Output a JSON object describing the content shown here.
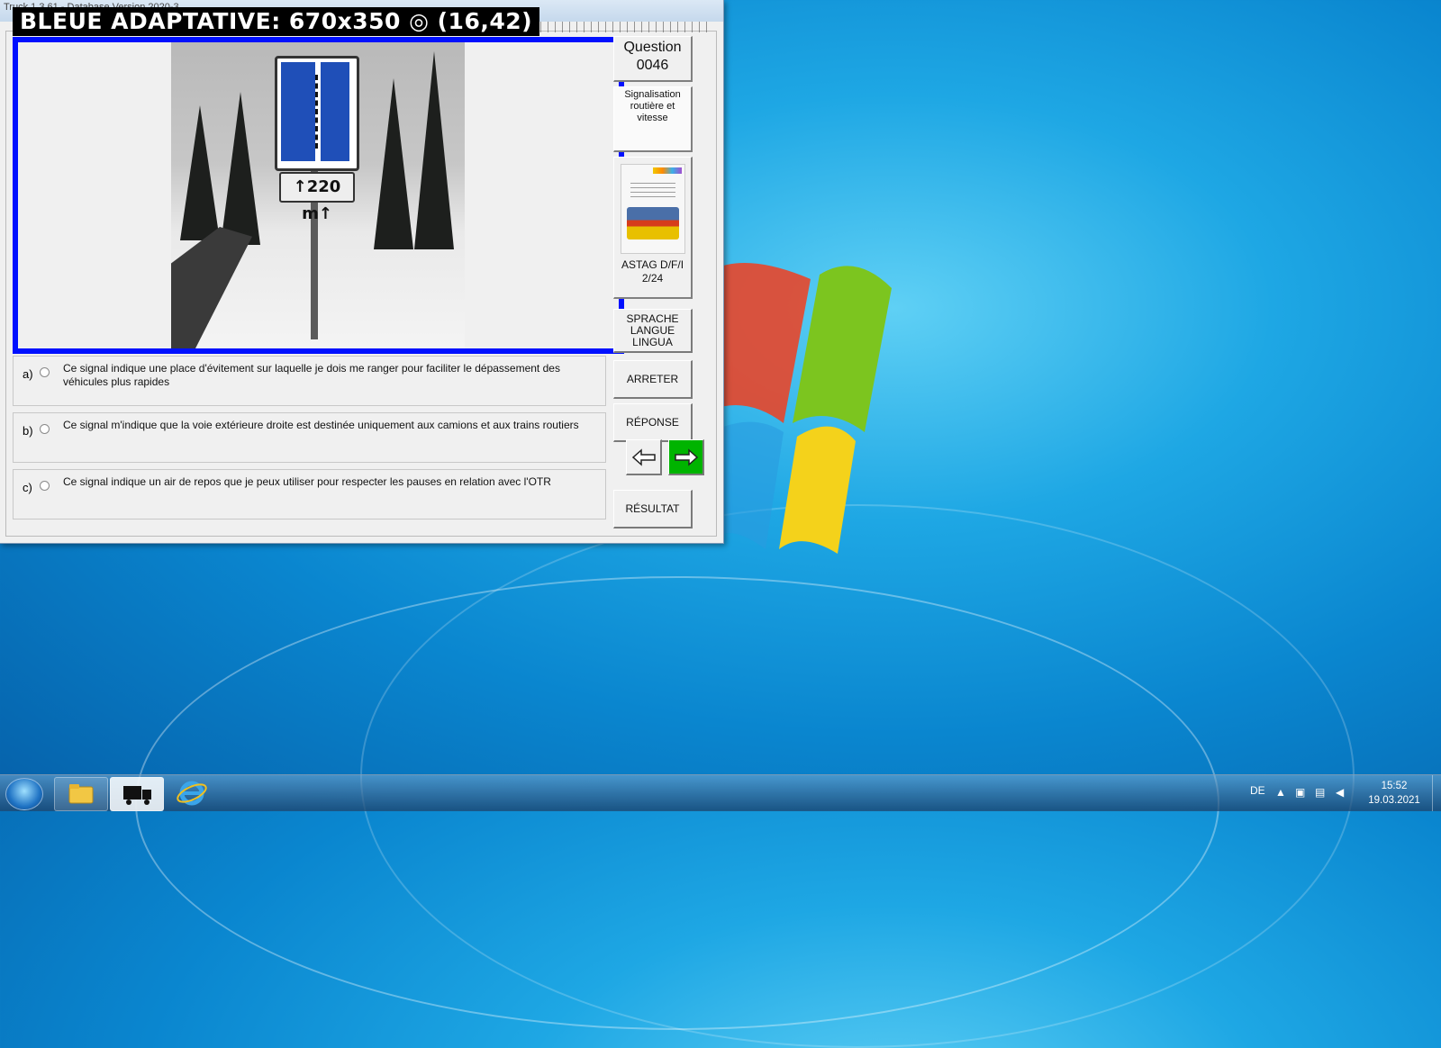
{
  "window": {
    "title": "Truck 1.3.61 - Database Version 2020-3",
    "overlay_banner": "BLEUE ADAPTATIVE: 670x350 ◎ (16,42)"
  },
  "question": {
    "label": "Question",
    "number": "0046",
    "category": "Signalisation routière et vitesse",
    "image_sign_text": "↑220 m↑"
  },
  "book": {
    "label_line1": "ASTAG D/F/I",
    "label_line2": "2/24"
  },
  "answers": [
    {
      "letter": "a)",
      "text": "Ce signal indique une place d'évitement sur laquelle je dois me ranger pour faciliter le dépassement des véhicules plus rapides"
    },
    {
      "letter": "b)",
      "text": "Ce signal m'indique que la voie extérieure droite est destinée uniquement aux camions et aux trains routiers"
    },
    {
      "letter": "c)",
      "text": "Ce signal indique un air de repos que je peux utiliser pour respecter les pauses en relation avec l'OTR"
    }
  ],
  "buttons": {
    "language": "SPRACHE\nLANGUE\nLINGUA",
    "stop": "ARRETER",
    "answer": "RÉPONSE",
    "result": "RÉSULTAT"
  },
  "colors": {
    "image_frame": "#0010ff",
    "next_button": "#00b400"
  },
  "taskbar": {
    "language": "DE",
    "time": "15:52",
    "date": "19.03.2021"
  }
}
